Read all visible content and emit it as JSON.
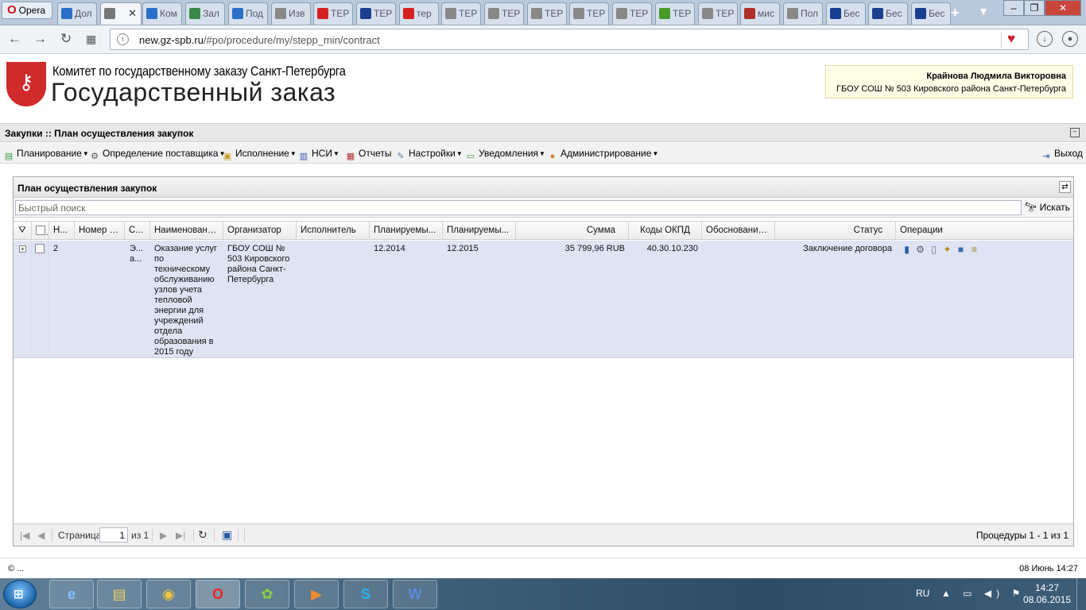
{
  "browser": {
    "menu_label": "Opera",
    "tabs": [
      {
        "label": "Дол",
        "fav": "#2a70c8",
        "active": false
      },
      {
        "label": "",
        "fav": "#777777",
        "active": true
      },
      {
        "label": "Ком",
        "fav": "#2a70c8",
        "active": false
      },
      {
        "label": "Зал",
        "fav": "#3a8a4a",
        "active": false
      },
      {
        "label": "Под",
        "fav": "#2a70c8",
        "active": false
      },
      {
        "label": "Изв",
        "fav": "#888888",
        "active": false
      },
      {
        "label": "ТЕР",
        "fav": "#d42020",
        "active": false
      },
      {
        "label": "ТЕР",
        "fav": "#1a3f8f",
        "active": false
      },
      {
        "label": "тер",
        "fav": "#d42020",
        "active": false
      },
      {
        "label": "ТЕР",
        "fav": "#888888",
        "active": false
      },
      {
        "label": "ТЕР",
        "fav": "#888888",
        "active": false
      },
      {
        "label": "ТЕР",
        "fav": "#888888",
        "active": false
      },
      {
        "label": "ТЕР",
        "fav": "#888888",
        "active": false
      },
      {
        "label": "ТЕР",
        "fav": "#888888",
        "active": false
      },
      {
        "label": "ТЕР",
        "fav": "#4a9a2a",
        "active": false
      },
      {
        "label": "ТЕР",
        "fav": "#888888",
        "active": false
      },
      {
        "label": "мис",
        "fav": "#b0302a",
        "active": false
      },
      {
        "label": "Пол",
        "fav": "#888888",
        "active": false
      },
      {
        "label": "Бес",
        "fav": "#1a3f8f",
        "active": false
      },
      {
        "label": "Бес",
        "fav": "#1a3f8f",
        "active": false
      },
      {
        "label": "Бес",
        "fav": "#1a3f8f",
        "active": false
      }
    ],
    "url_host": "new.gz-spb.ru",
    "url_path": "/#po/procedure/my/stepp_min/contract"
  },
  "site": {
    "committee": "Комитет по государственному заказу Санкт-Петербурга",
    "title": "Государственный заказ",
    "user_name": "Крайнова Людмила Викторовна",
    "user_org": "ГБОУ СОШ № 503 Кировского района Санкт-Петербурга"
  },
  "section": {
    "title": "Закупки :: План осуществления закупок"
  },
  "menu": {
    "items": [
      {
        "label": "Планирование",
        "icon": "planning-icon",
        "color": "#3a9a3a"
      },
      {
        "label": "Определение поставщика",
        "icon": "gears-icon",
        "color": "#555555"
      },
      {
        "label": "Исполнение",
        "icon": "briefcase-icon",
        "color": "#c89a20"
      },
      {
        "label": "НСИ",
        "icon": "book-icon",
        "color": "#2a5aa8"
      },
      {
        "label": "Отчеты",
        "icon": "report-icon",
        "color": "#b03030"
      },
      {
        "label": "Настройки",
        "icon": "wrench-icon",
        "color": "#6080a0"
      },
      {
        "label": "Уведомления",
        "icon": "notification-icon",
        "color": "#4aa040"
      },
      {
        "label": "Администрирование",
        "icon": "admin-user-icon",
        "color": "#d08030"
      }
    ],
    "exit_label": "Выход"
  },
  "panel": {
    "title": "План осуществления закупок",
    "search_placeholder": "Быстрый поиск",
    "search_button": "Искать",
    "columns": {
      "num": "Н...",
      "pg_number": "Номер ПГ",
      "s": "С...",
      "name": "Наименовани...",
      "organizer": "Организатор",
      "executor": "Исполнитель",
      "planned1": "Планируемы...",
      "planned2": "Планируемы...",
      "sum": "Сумма",
      "okpd": "Коды ОКПД",
      "justification": "Обоснование...",
      "status": "Статус",
      "operations": "Операции"
    },
    "row": {
      "num": "2",
      "pg_number": "",
      "s": "Э... а...",
      "name": "Оказание услуг по техническому обслуживанию узлов учета тепловой энергии для учреждений отдела образования в 2015 году",
      "organizer": "ГБОУ СОШ № 503 Кировского района Санкт-Петербурга",
      "executor": "",
      "planned1": "12.2014",
      "planned2": "12.2015",
      "sum": "35 799,96 RUB",
      "okpd": "40.30.10.230",
      "justification": "",
      "status": "Заключение договора"
    },
    "pager": {
      "page_label": "Страница",
      "page_value": "1",
      "of_label": "из 1",
      "summary": "Процедуры 1 - 1 из 1"
    }
  },
  "footer": {
    "left": "© ...",
    "right": "08 Июнь 14:27"
  },
  "taskbar": {
    "lang": "RU",
    "time": "14:27",
    "date": "08.06.2015"
  }
}
